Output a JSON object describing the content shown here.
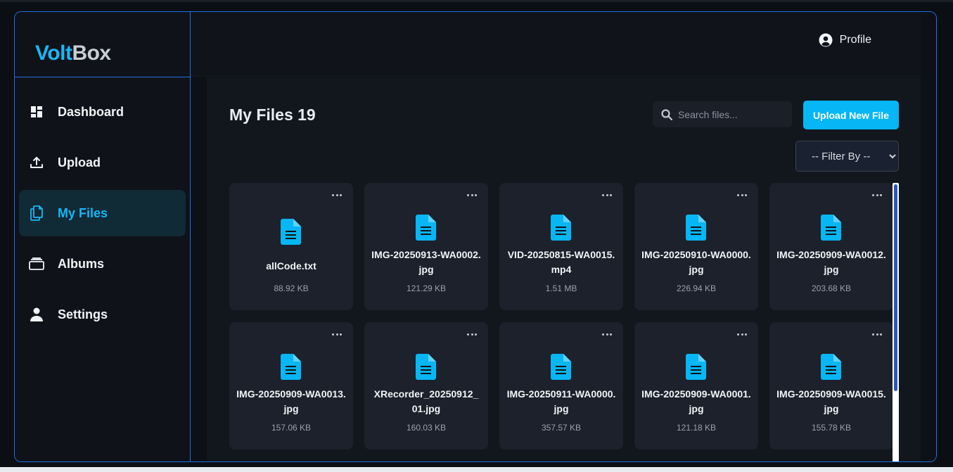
{
  "brand": {
    "part1": "Volt",
    "part2": "Box"
  },
  "sidebar": {
    "items": [
      {
        "label": "Dashboard",
        "icon": "dashboard-icon",
        "active": false
      },
      {
        "label": "Upload",
        "icon": "upload-icon",
        "active": false
      },
      {
        "label": "My Files",
        "icon": "files-icon",
        "active": true
      },
      {
        "label": "Albums",
        "icon": "albums-icon",
        "active": false
      },
      {
        "label": "Settings",
        "icon": "user-icon",
        "active": false
      }
    ]
  },
  "topbar": {
    "profile_label": "Profile",
    "profile_icon": "user-circle-icon"
  },
  "page": {
    "title": "My Files 19",
    "search_placeholder": "Search files...",
    "upload_label": "Upload New File",
    "filter_label": "-- Filter By --"
  },
  "files": [
    {
      "name": "allCode.txt",
      "size": "88.92 KB"
    },
    {
      "name": "IMG-20250913-WA0002.jpg",
      "size": "121.29 KB"
    },
    {
      "name": "VID-20250815-WA0015.mp4",
      "size": "1.51 MB"
    },
    {
      "name": "IMG-20250910-WA0000.jpg",
      "size": "226.94 KB"
    },
    {
      "name": "IMG-20250909-WA0012.jpg",
      "size": "203.68 KB"
    },
    {
      "name": "IMG-20250909-WA0013.jpg",
      "size": "157.06 KB"
    },
    {
      "name": "XRecorder_20250912_01.jpg",
      "size": "160.03 KB"
    },
    {
      "name": "IMG-20250911-WA0000.jpg",
      "size": "357.57 KB"
    },
    {
      "name": "IMG-20250909-WA0001.jpg",
      "size": "121.18 KB"
    },
    {
      "name": "IMG-20250909-WA0015.jpg",
      "size": "155.78 KB"
    }
  ],
  "colors": {
    "accent": "#06b6f5",
    "border": "#1f6feb",
    "card": "#1c212b"
  }
}
